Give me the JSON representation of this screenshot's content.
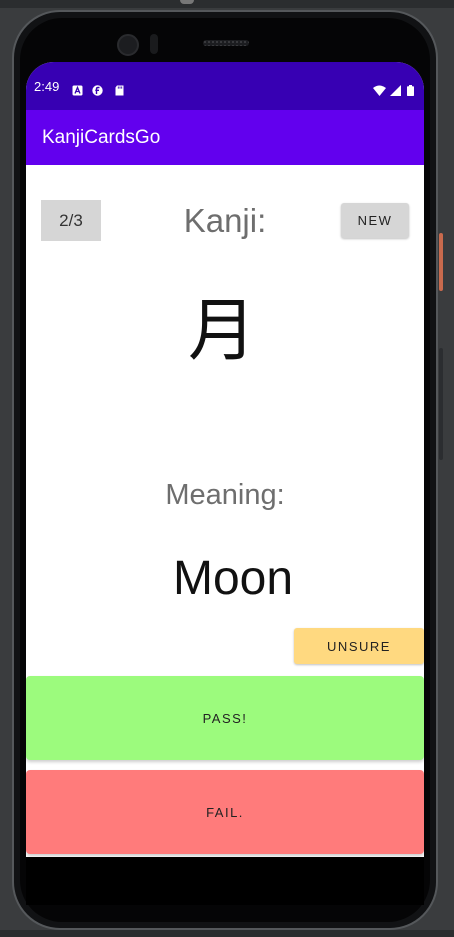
{
  "status_bar": {
    "time": "2:49",
    "left_icons": [
      "a-notification-icon",
      "f-notification-icon",
      "sd-card-icon"
    ],
    "right_icons": [
      "wifi-icon",
      "cell-signal-icon",
      "battery-icon"
    ],
    "color": "#3700b3"
  },
  "app_bar": {
    "title": "KanjiCardsGo",
    "color": "#6200ee"
  },
  "card": {
    "counter": "2/3",
    "new_label": "NEW",
    "kanji_heading": "Kanji:",
    "kanji": "月",
    "meaning_heading": "Meaning:",
    "meaning": "Moon"
  },
  "actions": {
    "unsure_label": "UNSURE",
    "pass_label": "PASS!",
    "fail_label": "FAIL.",
    "unsure_color": "#ffd980",
    "pass_color": "#9cfb7d",
    "fail_color": "#ff7b7b"
  }
}
